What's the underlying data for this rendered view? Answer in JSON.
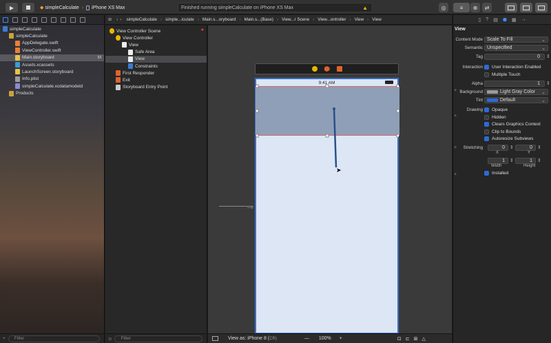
{
  "toolbar": {
    "scheme": "simpleCalculate",
    "device": "iPhone XS Max",
    "status": "Finished running simpleCalculate on iPhone XS Max"
  },
  "jumpbar": [
    "simpleCalculate",
    "simple...iculate",
    "Main.s...oryboard",
    "Main.s...(Base)",
    "View...r Scene",
    "View...ontroller",
    "View",
    "View"
  ],
  "navigator": {
    "items": [
      {
        "label": "simpleCalculate",
        "indent": 0,
        "kind": "project"
      },
      {
        "label": "simpleCalculate",
        "indent": 1,
        "kind": "folder"
      },
      {
        "label": "AppDelegate.swift",
        "indent": 2,
        "kind": "swift"
      },
      {
        "label": "ViewController.swift",
        "indent": 2,
        "kind": "swift"
      },
      {
        "label": "Main.storyboard",
        "indent": 2,
        "kind": "storyboard",
        "badge": "M"
      },
      {
        "label": "Assets.xcassets",
        "indent": 2,
        "kind": "assets"
      },
      {
        "label": "LaunchScreen.storyboard",
        "indent": 2,
        "kind": "storyboard"
      },
      {
        "label": "Info.plist",
        "indent": 2,
        "kind": "plist"
      },
      {
        "label": "simpleCalculate.xcdatamodeld",
        "indent": 2,
        "kind": "data"
      },
      {
        "label": "Products",
        "indent": 1,
        "kind": "folder"
      }
    ],
    "filter": "Filter"
  },
  "outline": {
    "items": [
      {
        "label": "View Controller Scene",
        "indent": 0,
        "kind": "scene"
      },
      {
        "label": "View Controller",
        "indent": 1,
        "kind": "vc"
      },
      {
        "label": "View",
        "indent": 2,
        "kind": "view"
      },
      {
        "label": "Safe Area",
        "indent": 3,
        "kind": "view"
      },
      {
        "label": "View",
        "indent": 3,
        "kind": "view"
      },
      {
        "label": "Constraints",
        "indent": 3,
        "kind": "constraints"
      },
      {
        "label": "First Responder",
        "indent": 1,
        "kind": "responder"
      },
      {
        "label": "Exit",
        "indent": 1,
        "kind": "exit"
      },
      {
        "label": "Storyboard Entry Point",
        "indent": 1,
        "kind": "entry"
      }
    ],
    "filter": "Filter"
  },
  "canvas": {
    "time": "9:41 AM",
    "view_as": "View as: iPhone 8 (",
    "view_as_suffix": "C",
    "view_as_r": "R)",
    "zoom_minus": "—",
    "zoom": "100%",
    "zoom_plus": "+"
  },
  "inspector": {
    "title": "View",
    "rows": [
      {
        "label": "Content Mode",
        "value": "Scale To Fill",
        "type": "select"
      },
      {
        "label": "Semantic",
        "value": "Unspecified",
        "type": "select"
      },
      {
        "label": "Tag",
        "value": "0",
        "type": "num"
      },
      {
        "label": "Interaction",
        "checks": [
          {
            "label": "User Interaction Enabled",
            "on": true
          },
          {
            "label": "Multiple Touch",
            "on": false
          }
        ]
      },
      {
        "label": "Alpha",
        "value": "1",
        "type": "num"
      },
      {
        "label": "Background",
        "value": "Light Gray Color",
        "type": "color",
        "swatch": "#9a9a9a"
      },
      {
        "label": "Tint",
        "value": "Default",
        "type": "color",
        "swatch": "#2d6bd6"
      },
      {
        "label": "Drawing",
        "checks": [
          {
            "label": "Opaque",
            "on": true
          },
          {
            "label": "Hidden",
            "on": false
          },
          {
            "label": "Clears Graphics Context",
            "on": true
          },
          {
            "label": "Clip to Bounds",
            "on": false
          },
          {
            "label": "Autoresize Subviews",
            "on": true
          }
        ]
      },
      {
        "label": "Stretching",
        "stretch": [
          "0",
          "0",
          "1",
          "1"
        ],
        "sub": [
          "X",
          "Y",
          "Width",
          "Height"
        ]
      }
    ],
    "installed": "Installed"
  }
}
